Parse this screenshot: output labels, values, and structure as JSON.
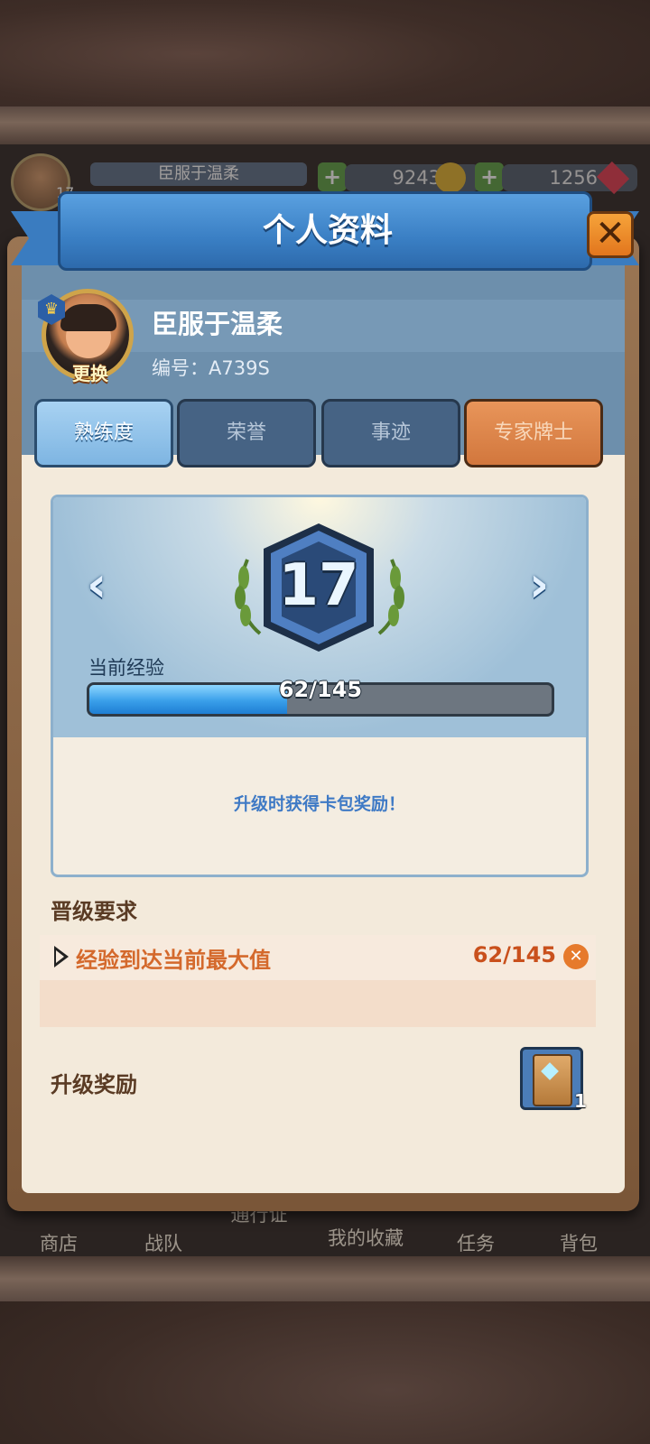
{
  "hud": {
    "player_name": "臣服于温柔",
    "player_exp": "62/145",
    "player_level": "17",
    "gold": "9243",
    "gems": "1256"
  },
  "bottom_nav": [
    "商店",
    "战队",
    "通行证",
    "我的收藏",
    "任务",
    "背包"
  ],
  "dialog": {
    "title": "个人资料",
    "close_icon": "close-icon"
  },
  "profile": {
    "name": "臣服于温柔",
    "id_label": "编号：A739S",
    "change_label": "更换"
  },
  "tabs": [
    {
      "label": "熟练度",
      "state": "active"
    },
    {
      "label": "荣誉",
      "state": "inactive"
    },
    {
      "label": "事迹",
      "state": "inactive"
    },
    {
      "label": "专家牌士",
      "state": "orange"
    }
  ],
  "level": {
    "value": "17",
    "exp_label": "当前经验",
    "exp_text": "62/145",
    "exp_current": 62,
    "exp_max": 145,
    "reward_hint": "升级时获得卡包奖励！"
  },
  "requirements": {
    "title": "晋级要求",
    "items": [
      {
        "text": "经验到达当前最大值",
        "value": "62/145",
        "status_icon": "close-circle-icon"
      }
    ]
  },
  "rewards": {
    "title": "升级奖励",
    "items": [
      {
        "icon": "card-pack-icon",
        "count": "1"
      }
    ]
  },
  "colors": {
    "ribbon": "#3a7fc4",
    "accent_orange": "#d4692c",
    "panel_bg": "#f3eadb"
  }
}
